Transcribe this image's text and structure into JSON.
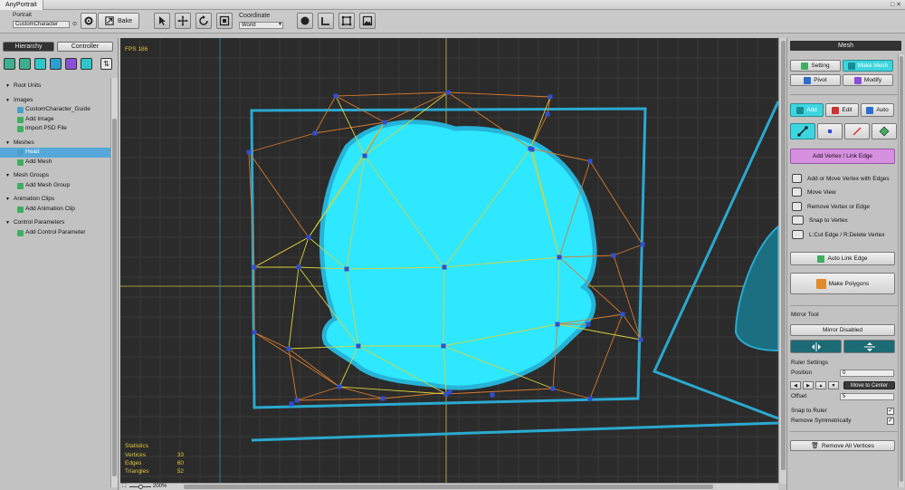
{
  "app": {
    "title": "AnyPortrait",
    "window_controls": "□ ✕"
  },
  "toolbar": {
    "portrait_label": "Portrait",
    "portrait_value": "CustomCharacter",
    "bake_label": "Bake",
    "coordinate_label": "Coordinate",
    "coordinate_value": "World"
  },
  "left_panel": {
    "tabs": [
      {
        "label": "Hierarchy"
      },
      {
        "label": "Controller"
      }
    ],
    "tree": [
      {
        "label": "Root Units",
        "type": "category"
      },
      {
        "label": "Images",
        "type": "category"
      },
      {
        "label": "CustomCharacter_Guide",
        "type": "item"
      },
      {
        "label": "Add Image",
        "type": "action"
      },
      {
        "label": "Import PSD File",
        "type": "action"
      },
      {
        "label": "Meshes",
        "type": "category"
      },
      {
        "label": "Head",
        "type": "item",
        "selected": true
      },
      {
        "label": "Add Mesh",
        "type": "action"
      },
      {
        "label": "Mesh Groups",
        "type": "category"
      },
      {
        "label": "Add Mesh Group",
        "type": "action"
      },
      {
        "label": "Animation Clips",
        "type": "category"
      },
      {
        "label": "Add Animation Clip",
        "type": "action"
      },
      {
        "label": "Control Parameters",
        "type": "category"
      },
      {
        "label": "Add Control Parameter",
        "type": "action"
      }
    ]
  },
  "viewport": {
    "fps": "FPS 186",
    "stats_title": "Statistics",
    "stats": [
      {
        "label": "Vertices",
        "value": "33"
      },
      {
        "label": "Edges",
        "value": "60"
      },
      {
        "label": "Triangles",
        "value": "52"
      }
    ],
    "zoom": "200%"
  },
  "right_panel": {
    "header": "Mesh",
    "setting": "Setting",
    "make_mesh": "Make Mesh",
    "pivot": "Pivot",
    "modify": "Modify",
    "add": "Add",
    "edit": "Edit",
    "auto": "Auto",
    "add_vertex_link_edge": "Add Vertex / Link Edge",
    "legend": [
      "Add or Move Vertex with Edges",
      "Move View",
      "Remove Vertex or Edge",
      "Snap to Vertex",
      "L:Cut Edge / R:Delete Vertex"
    ],
    "auto_link_edge": "Auto Link Edge",
    "make_polygons": "Make Polygons",
    "mirror_tool_label": "Mirror Tool",
    "mirror_disabled": "Mirror Disabled",
    "ruler_settings": "Ruler Settings",
    "position_label": "Position",
    "position_value": "0",
    "move_to_center": "Move to Center",
    "offset_label": "Offset",
    "offset_value": "5",
    "snap_to_ruler": "Snap to Ruler",
    "snap_to_ruler_checked": "✓",
    "remove_symmetrically": "Remove Symmetrically",
    "remove_symmetrically_checked": "✓",
    "remove_all_vertices": "Remove All Vertices"
  },
  "colors": {
    "mesh_fill": "#2ee8ff",
    "mesh_outline": "#27b3d8",
    "edge_outer": "#d77a2d",
    "edge_inner": "#d7d23a",
    "vertex": "#2f4fd0",
    "accent": "#3dd6e0",
    "stats_text": "#e0c53a"
  }
}
